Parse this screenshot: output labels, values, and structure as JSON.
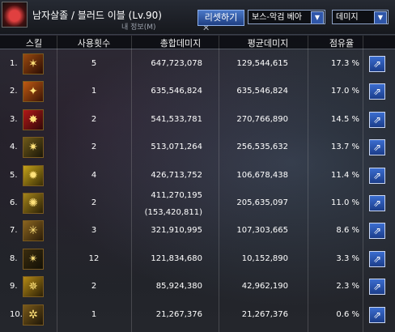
{
  "window": {
    "character_title": "남자살졸 / 블러드 이블 (Lv.90)",
    "subtitle": "내 정보(M)",
    "close_glyph": "✕",
    "reset_label": "리셋하기",
    "boss_select": {
      "value": "보스-악검 베아"
    },
    "type_select": {
      "value": "데미지"
    },
    "dropdown_arrow": "▼"
  },
  "table": {
    "headers": [
      "스킬",
      "사용횟수",
      "총합데미지",
      "평균데미지",
      "점유율"
    ],
    "rows": [
      {
        "rank": "1.",
        "icon": "skill-1-icon",
        "glyph": "✶",
        "count": "5",
        "total": "647,723,078",
        "avg": "129,544,615",
        "share": "17.3 %"
      },
      {
        "rank": "2.",
        "icon": "skill-2-icon",
        "glyph": "✦",
        "count": "1",
        "total": "635,546,824",
        "avg": "635,546,824",
        "share": "17.0 %"
      },
      {
        "rank": "3.",
        "icon": "skill-3-icon",
        "glyph": "✸",
        "count": "2",
        "total": "541,533,781",
        "avg": "270,766,890",
        "share": "14.5 %"
      },
      {
        "rank": "4.",
        "icon": "skill-4-icon",
        "glyph": "✷",
        "count": "2",
        "total": "513,071,264",
        "avg": "256,535,632",
        "share": "13.7 %"
      },
      {
        "rank": "5.",
        "icon": "skill-5-icon",
        "glyph": "✹",
        "count": "4",
        "total": "426,713,752",
        "avg": "106,678,438",
        "share": "11.4 %"
      },
      {
        "rank": "6.",
        "icon": "skill-6-icon",
        "glyph": "✺",
        "count": "2",
        "total": "411,270,195",
        "subtotal": "(153,420,811)",
        "avg": "205,635,097",
        "share": "11.0 %"
      },
      {
        "rank": "7.",
        "icon": "skill-7-icon",
        "glyph": "✳",
        "count": "3",
        "total": "321,910,995",
        "avg": "107,303,665",
        "share": "8.6 %"
      },
      {
        "rank": "8.",
        "icon": "skill-8-icon",
        "glyph": "✴",
        "count": "12",
        "total": "121,834,680",
        "avg": "10,152,890",
        "share": "3.3 %"
      },
      {
        "rank": "9.",
        "icon": "skill-9-icon",
        "glyph": "✵",
        "count": "2",
        "total": "85,924,380",
        "avg": "42,962,190",
        "share": "2.3 %"
      },
      {
        "rank": "10.",
        "icon": "skill-10-icon",
        "glyph": "✲",
        "count": "1",
        "total": "21,267,376",
        "avg": "21,267,376",
        "share": "0.6 %"
      }
    ],
    "detail_glyph": "⇗"
  },
  "colors": {
    "accent": "#2f56a8",
    "text": "#ffffff",
    "header_bg": "#0a0c10"
  }
}
